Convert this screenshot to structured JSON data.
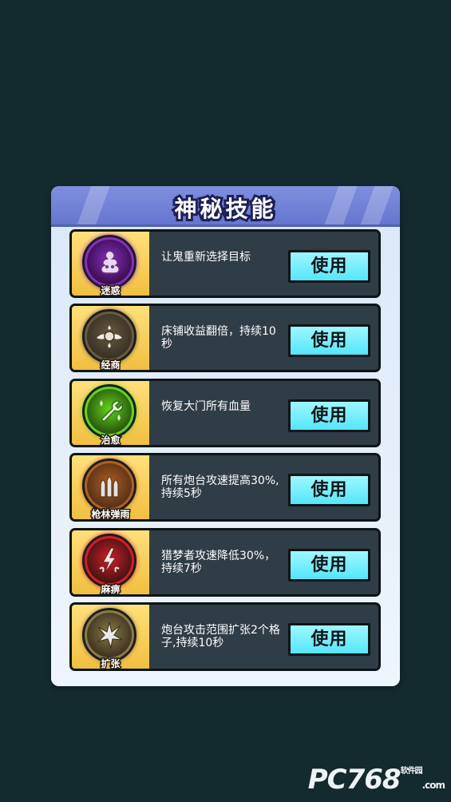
{
  "panel": {
    "title": "神秘技能"
  },
  "skills": [
    {
      "name": "迷惑",
      "desc": "让鬼重新选择目标",
      "button": "使用",
      "icon": "ghost-smoke-icon",
      "colors": {
        "ring": "#8a2cc4",
        "inner": "#3c1052"
      }
    },
    {
      "name": "经商",
      "desc": "床铺收益翻倍，持续10秒",
      "button": "使用",
      "icon": "coin-wing-icon",
      "colors": {
        "ring": "#6a5a40",
        "inner": "#3a3226"
      }
    },
    {
      "name": "治愈",
      "desc": "恢复大门所有血量",
      "button": "使用",
      "icon": "wrench-heal-icon",
      "colors": {
        "ring": "#62d41c",
        "inner": "#2a5a0e"
      }
    },
    {
      "name": "枪林弹雨",
      "desc": "所有炮台攻速提高30%,持续5秒",
      "button": "使用",
      "icon": "bullets-icon",
      "colors": {
        "ring": "#b0601e",
        "inner": "#5a321a"
      }
    },
    {
      "name": "麻痹",
      "desc": "猎梦者攻速降低30%，持续7秒",
      "button": "使用",
      "icon": "lightning-icon",
      "colors": {
        "ring": "#d41e28",
        "inner": "#4a1414"
      }
    },
    {
      "name": "扩张",
      "desc": "炮台攻击范围扩张2个格子,持续10秒",
      "button": "使用",
      "icon": "burst-icon",
      "colors": {
        "ring": "#8c7a48",
        "inner": "#403620"
      }
    }
  ],
  "watermark": {
    "text": "PC768",
    "sub": "软件园",
    "domain": ".com"
  }
}
